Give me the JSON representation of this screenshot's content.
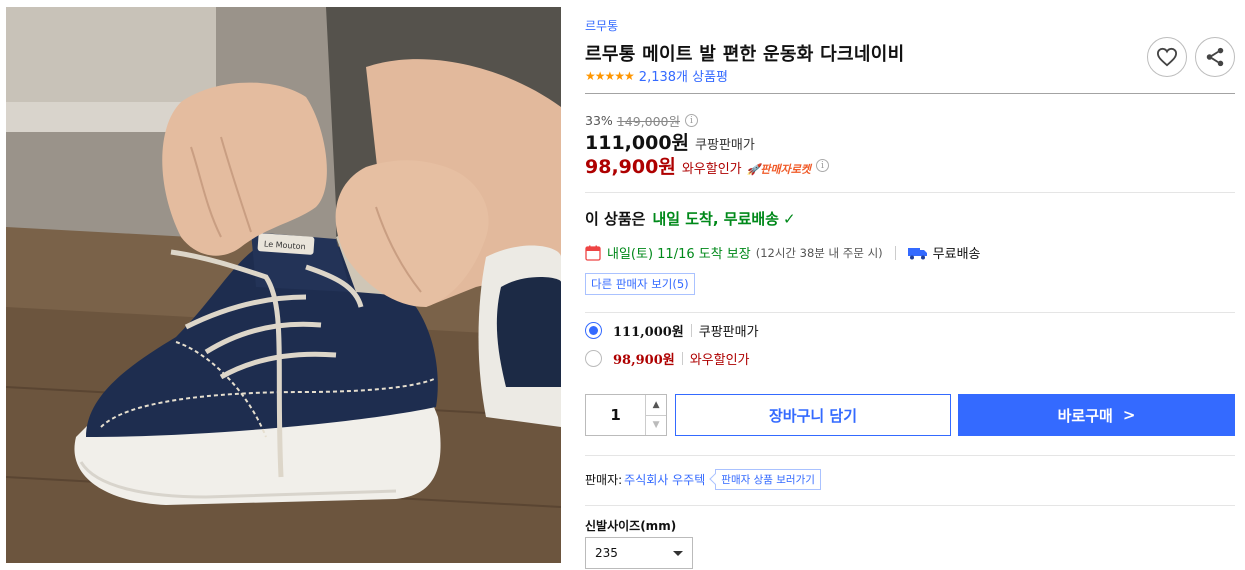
{
  "product": {
    "brand": "르무통",
    "title": "르무통 메이트 발 편한 운동화 다크네이비",
    "stars": "★★★★★",
    "review_count": "2,138개 상품평",
    "rating": 5
  },
  "pricing": {
    "discount_rate": "33%",
    "original_price": "149,000원",
    "price": "111,000원",
    "price_label": "쿠팡판매가",
    "wow_price": "98,900원",
    "wow_label": "와우할인가",
    "rocket_badge": "판매자로켓"
  },
  "delivery": {
    "headline_prefix": "이 상품은",
    "headline_highlight": "내일 도착, 무료배송",
    "date_text": "내일(토) 11/16 도착 보장",
    "cutoff_note": "(12시간 38분 내 주문 시)",
    "shipping": "무료배송",
    "other_sellers": "다른 판매자 보기(5)"
  },
  "options": [
    {
      "price": "111,000원",
      "label": "쿠팡판매가",
      "selected": true
    },
    {
      "price": "98,900원",
      "label": "와우할인가",
      "selected": false
    }
  ],
  "purchase": {
    "quantity": "1",
    "cart_label": "장바구니 담기",
    "buy_label": "바로구매"
  },
  "seller": {
    "prefix": "판매자:",
    "name": "주식회사 우주텍",
    "tag": "판매자 상품 보러가기"
  },
  "size": {
    "label": "신발사이즈(mm)",
    "selected": "235"
  },
  "photo": {
    "tongue_label": "Le Mouton"
  },
  "colors": {
    "accent": "#346aff",
    "wow_red": "#ae0000",
    "green": "#00891a",
    "star": "#ff9600"
  },
  "icons": {
    "wish": "heart-icon",
    "share": "share-icon",
    "calendar": "calendar-icon",
    "truck": "truck-icon",
    "info": "info-icon",
    "check": "check-icon",
    "rocket": "rocket-icon",
    "dropdown": "caret-down-icon"
  }
}
